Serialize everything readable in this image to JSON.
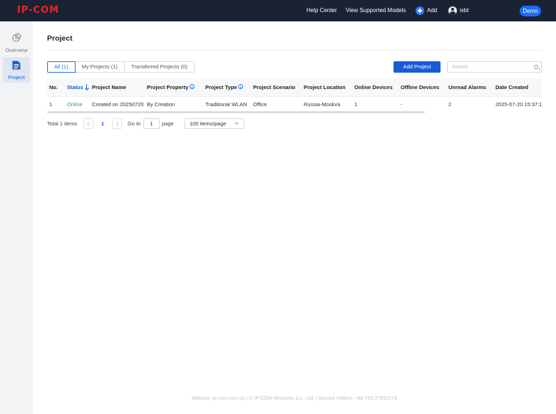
{
  "brand": {
    "logo_text": "IP-COM"
  },
  "topbar": {
    "help_center": "Help Center",
    "view_models": "View Supported Models",
    "add_label": "Add",
    "username": "ixbt",
    "demo_label": "Demo"
  },
  "sidebar": {
    "items": [
      {
        "label": "Overview",
        "icon": "pie-chart-icon"
      },
      {
        "label": "Project",
        "icon": "document-icon",
        "active": true
      }
    ]
  },
  "page": {
    "title": "Project"
  },
  "tabs": [
    {
      "label": "All (1)",
      "active": true
    },
    {
      "label": "My Projects (1)"
    },
    {
      "label": "Transferred Projects (0)"
    }
  ],
  "toolbar": {
    "add_project_label": "Add Project",
    "search_placeholder": "Search"
  },
  "table": {
    "columns": [
      "No.",
      "Status",
      "Project Name",
      "Project Property",
      "Project Type",
      "Project Scenario",
      "Project Location",
      "Online Devices",
      "Offline Devices",
      "Unread Alarms",
      "Date Created"
    ],
    "rows": [
      [
        "1",
        "Online",
        "Created on 20250720",
        "By Creation",
        "Traditional WLAN",
        "Office",
        "Russia-Moskva",
        "1",
        "-",
        "2",
        "2025-07-20 15:37:1"
      ]
    ]
  },
  "pagination": {
    "total_label": "Total 1 items",
    "current_page": "1",
    "goto_label": "Go to",
    "goto_value": "1",
    "page_label": "page",
    "per_page": "100 items/page"
  },
  "footer": {
    "text": "Website: ip-com.com.cn | © IP-COM Networks Co., Ltd. | Service Hotline: +86-755-27657178"
  },
  "colors": {
    "topbar": "#1b2233",
    "accent": "#1a5bd6",
    "brand": "#e8262c",
    "online": "#2aa94a"
  }
}
